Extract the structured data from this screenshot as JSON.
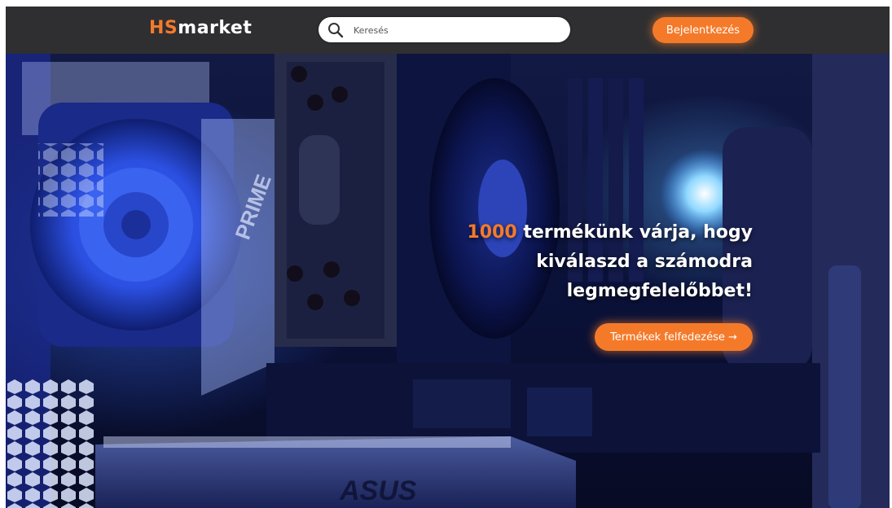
{
  "header": {
    "logo_prefix": "HS",
    "logo_suffix": "market",
    "search_placeholder": "Keresés",
    "login_label": "Bejelentkezés"
  },
  "hero": {
    "headline_highlight": "1000",
    "headline_line1": " termékünk várja, hogy",
    "headline_line2": "kiválaszd a számodra",
    "headline_line3": "legmegfelelőbbet!",
    "cta_label": "Termékek felfedezése →",
    "brand_print": "ASUS",
    "board_print": "PRIME"
  },
  "colors": {
    "accent": "#f47a2a",
    "header_bg": "#2f2f31",
    "search_bg": "#ffffff"
  },
  "icons": {
    "search": "search-icon"
  }
}
